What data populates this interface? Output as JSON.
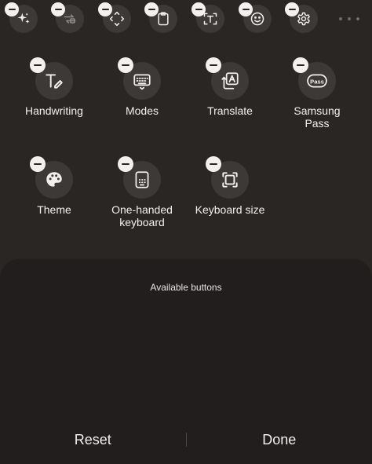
{
  "toolbar": {
    "buttons": [
      {
        "icon": "sparkle-icon"
      },
      {
        "icon": "swap-icon"
      },
      {
        "icon": "move-cursor-icon"
      },
      {
        "icon": "clipboard-icon"
      },
      {
        "icon": "text-extract-icon"
      },
      {
        "icon": "emoji-icon"
      },
      {
        "icon": "settings-gear-icon"
      }
    ],
    "more_icon": "more-dots-icon"
  },
  "items": [
    {
      "label": "Handwriting",
      "icon": "handwriting-icon"
    },
    {
      "label": "Modes",
      "icon": "keyboard-modes-icon"
    },
    {
      "label": "Translate",
      "icon": "translate-icon"
    },
    {
      "label": "Samsung\nPass",
      "icon": "samsung-pass-icon",
      "icon_text": "Pass"
    },
    {
      "label": "Theme",
      "icon": "palette-icon"
    },
    {
      "label": "One-handed\nkeyboard",
      "icon": "one-handed-keyboard-icon"
    },
    {
      "label": "Keyboard size",
      "icon": "keyboard-size-icon"
    }
  ],
  "sheet": {
    "title": "Available buttons",
    "reset_label": "Reset",
    "done_label": "Done"
  },
  "colors": {
    "background": "#2a2624",
    "sheet": "#211e1d",
    "button_circle": "#3d3937",
    "minus_badge": "#f3f1ef",
    "text": "#f2f0ee"
  }
}
